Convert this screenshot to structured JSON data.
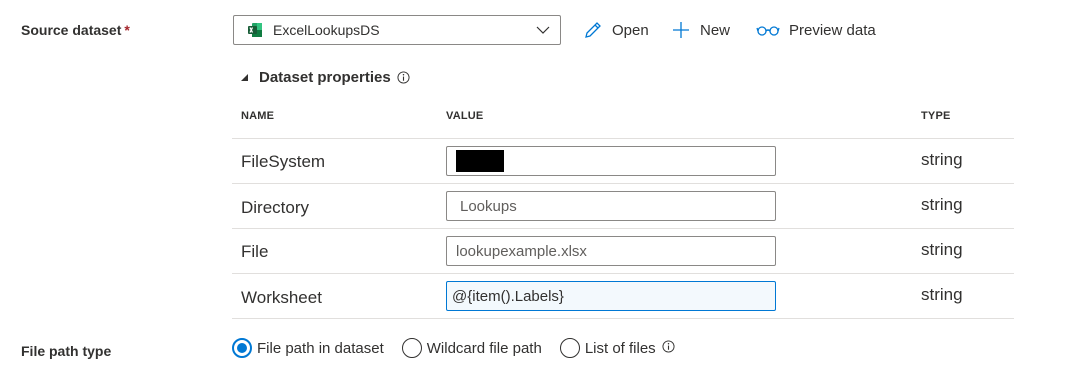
{
  "source": {
    "label": "Source dataset",
    "required_mark": "*",
    "selected": "ExcelLookupsDS",
    "open_label": "Open",
    "new_label": "New",
    "preview_label": "Preview data"
  },
  "dataset_properties": {
    "title": "Dataset properties",
    "columns": {
      "name": "NAME",
      "value": "VALUE",
      "type": "TYPE"
    },
    "rows": [
      {
        "name": "FileSystem",
        "value": "",
        "type": "string",
        "redacted": true
      },
      {
        "name": "Directory",
        "value": "Lookups",
        "type": "string"
      },
      {
        "name": "File",
        "value": "lookupexample.xlsx",
        "type": "string"
      },
      {
        "name": "Worksheet",
        "value": "@{item().Labels}",
        "type": "string",
        "focused": true
      }
    ]
  },
  "file_path_type": {
    "label": "File path type",
    "options": [
      {
        "label": "File path in dataset",
        "selected": true
      },
      {
        "label": "Wildcard file path",
        "selected": false
      },
      {
        "label": "List of files",
        "selected": false
      }
    ]
  },
  "colors": {
    "accent": "#0078d4",
    "excel_green": "#107c41",
    "required": "#a4262c"
  }
}
